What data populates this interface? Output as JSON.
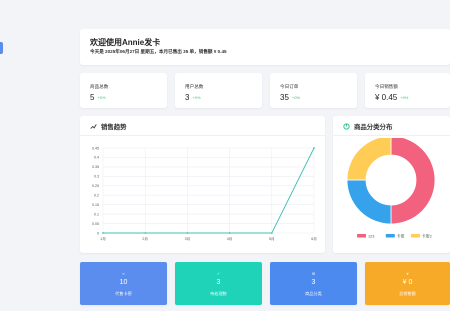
{
  "welcome": {
    "title": "欢迎使用Annie发卡",
    "subtitle": "今天是 2025年06月27日 星期五，本月已售出 35 单，销售额 ¥ 0.45"
  },
  "stats": [
    {
      "label": "商品总数",
      "value": "5",
      "change": "+0%"
    },
    {
      "label": "用户总数",
      "value": "3",
      "change": "+0%"
    },
    {
      "label": "今日订单",
      "value": "35",
      "change": "+0%"
    },
    {
      "label": "今日销售额",
      "value": "¥ 0.45",
      "change": "+0%"
    }
  ],
  "sales_trend": {
    "title": "销售趋势"
  },
  "category": {
    "title": "商品分类分布"
  },
  "quick_actions": [
    {
      "icon": "¤",
      "value": "10",
      "label": "代售卡密",
      "color": "#5b8def"
    },
    {
      "icon": "✓",
      "value": "3",
      "label": "待处理数",
      "color": "#1fd3b9"
    },
    {
      "icon": "⊞",
      "value": "3",
      "label": "商品分类",
      "color": "#4d8af0"
    },
    {
      "icon": "¥",
      "value": "¥ 0",
      "label": "总销售额",
      "color": "#f7a928"
    }
  ],
  "chart_data": [
    {
      "type": "line",
      "title": "销售趋势",
      "x": [
        "1月",
        "2月",
        "3月",
        "4月",
        "5月",
        "6月"
      ],
      "series": [
        {
          "values": [
            0,
            0,
            0,
            0,
            0,
            0.45
          ],
          "color": "#3fc1b4"
        }
      ],
      "y_ticks": [
        "0",
        "0.05",
        "0.1",
        "0.15",
        "0.2",
        "0.25",
        "0.3",
        "0.35",
        "0.4",
        "0.45"
      ],
      "ylim": [
        0,
        0.45
      ],
      "grid": true
    },
    {
      "type": "pie",
      "title": "商品分类分布",
      "categories": [
        "123",
        "卡密",
        "卡密2"
      ],
      "values": [
        2,
        1,
        1
      ],
      "colors": [
        "#f2617e",
        "#36a2eb",
        "#ffcd56"
      ],
      "legend": "bottom"
    }
  ]
}
